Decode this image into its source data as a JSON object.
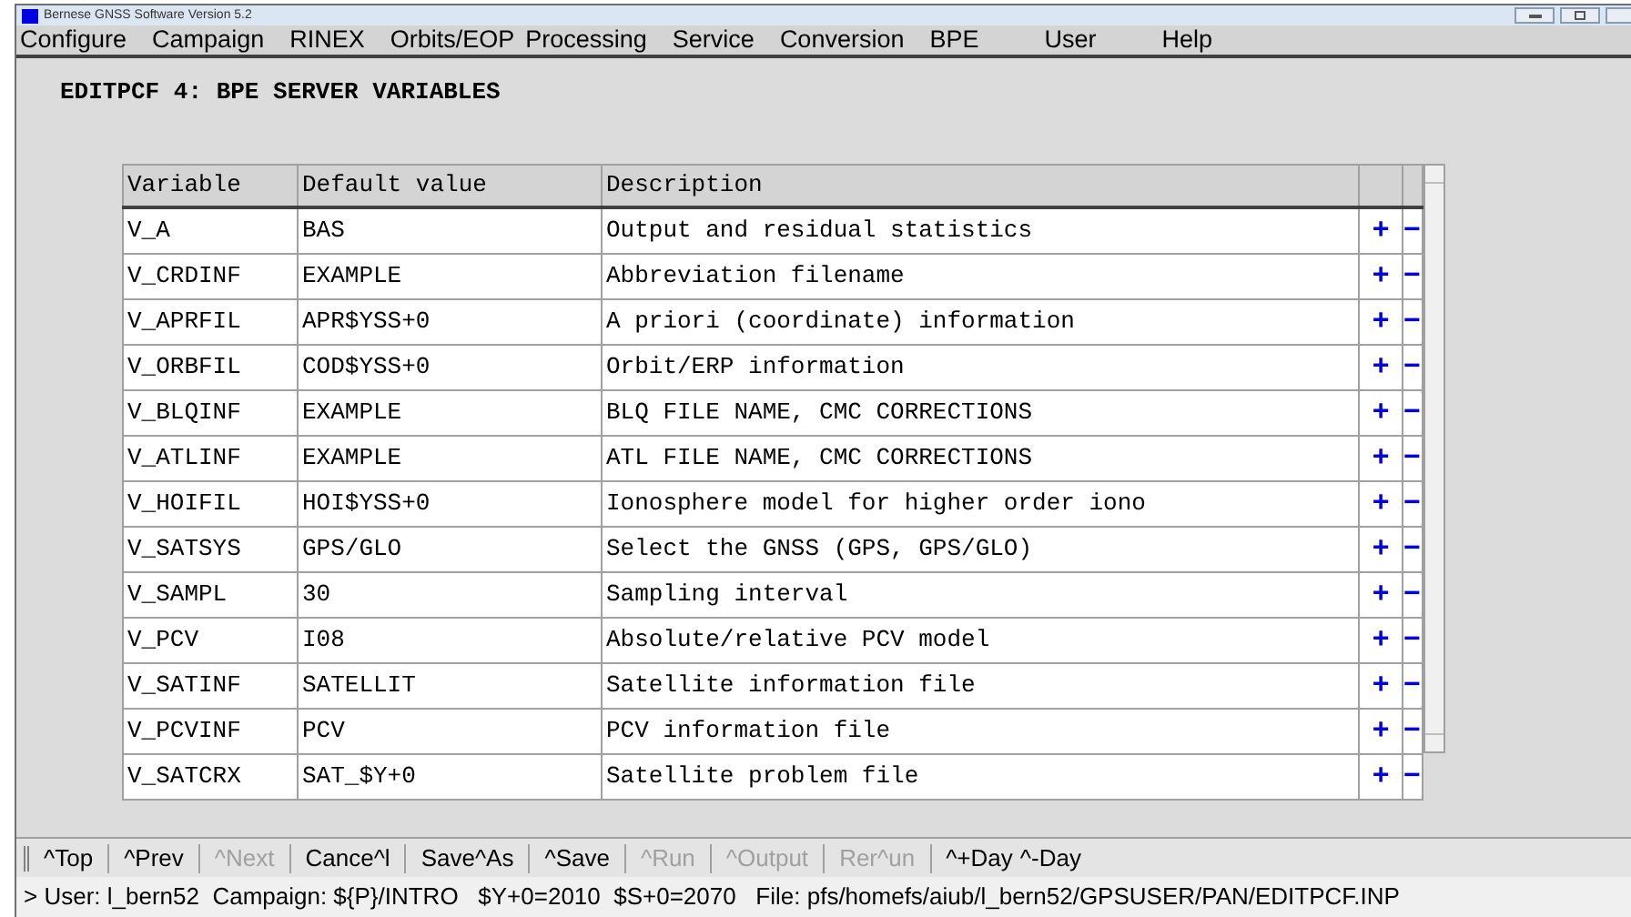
{
  "window": {
    "title": "Bernese GNSS Software Version 5.2"
  },
  "menu": [
    "Configure",
    "Campaign",
    "RINEX",
    "Orbits/EOP",
    "Processing",
    "Service",
    "Conversion",
    "BPE",
    "User",
    "Help"
  ],
  "heading": "EDITPCF 4: BPE SERVER VARIABLES",
  "table": {
    "columns": [
      "Variable",
      "Default value",
      "Description"
    ],
    "rows": [
      {
        "variable": "V_A",
        "default": "BAS",
        "description": "Output and residual statistics",
        "add": "+",
        "remove": "−"
      },
      {
        "variable": "V_CRDINF",
        "default": "EXAMPLE",
        "description": "Abbreviation filename",
        "add": "+",
        "remove": "−"
      },
      {
        "variable": "V_APRFIL",
        "default": "APR$YSS+0",
        "description": "A priori (coordinate) information",
        "add": "+",
        "remove": "−"
      },
      {
        "variable": "V_ORBFIL",
        "default": "COD$YSS+0",
        "description": "Orbit/ERP information",
        "add": "+",
        "remove": "−"
      },
      {
        "variable": "V_BLQINF",
        "default": "EXAMPLE",
        "description": "BLQ FILE NAME, CMC CORRECTIONS",
        "add": "+",
        "remove": "−"
      },
      {
        "variable": "V_ATLINF",
        "default": "EXAMPLE",
        "description": "ATL FILE NAME, CMC CORRECTIONS",
        "add": "+",
        "remove": "−"
      },
      {
        "variable": "V_HOIFIL",
        "default": "HOI$YSS+0",
        "description": "Ionosphere model for higher order iono",
        "add": "+",
        "remove": "−"
      },
      {
        "variable": "V_SATSYS",
        "default": "GPS/GLO",
        "description": "Select the GNSS (GPS, GPS/GLO)",
        "add": "+",
        "remove": "−"
      },
      {
        "variable": "V_SAMPL",
        "default": "30",
        "description": "Sampling interval",
        "add": "+",
        "remove": "−"
      },
      {
        "variable": "V_PCV",
        "default": "I08",
        "description": "Absolute/relative PCV model",
        "add": "+",
        "remove": "−"
      },
      {
        "variable": "V_SATINF",
        "default": "SATELLIT",
        "description": "Satellite information file",
        "add": "+",
        "remove": "−"
      },
      {
        "variable": "V_PCVINF",
        "default": "PCV",
        "description": "PCV information file",
        "add": "+",
        "remove": "−"
      },
      {
        "variable": "V_SATCRX",
        "default": "SAT_$Y+0",
        "description": "Satellite problem file",
        "add": "+",
        "remove": "−"
      }
    ]
  },
  "buttons": [
    {
      "label": "^Top",
      "disabled": false
    },
    {
      "label": "^Prev",
      "disabled": false
    },
    {
      "label": "^Next",
      "disabled": true
    },
    {
      "label": "Cance^l",
      "disabled": false
    },
    {
      "label": "Save^As",
      "disabled": false
    },
    {
      "label": "^Save",
      "disabled": false
    },
    {
      "label": "^Run",
      "disabled": true
    },
    {
      "label": "^Output",
      "disabled": true
    },
    {
      "label": "Rer^un",
      "disabled": true
    },
    {
      "label": "^+Day",
      "disabled": false
    },
    {
      "label": "^-Day",
      "disabled": false
    }
  ],
  "status_bar": "> User: l_bern52  Campaign: ${P}/INTRO   $Y+0=2010  $S+0=2070   File: pfs/homefs/aiub/l_bern52/GPSUSER/PAN/EDITPCF.INP"
}
